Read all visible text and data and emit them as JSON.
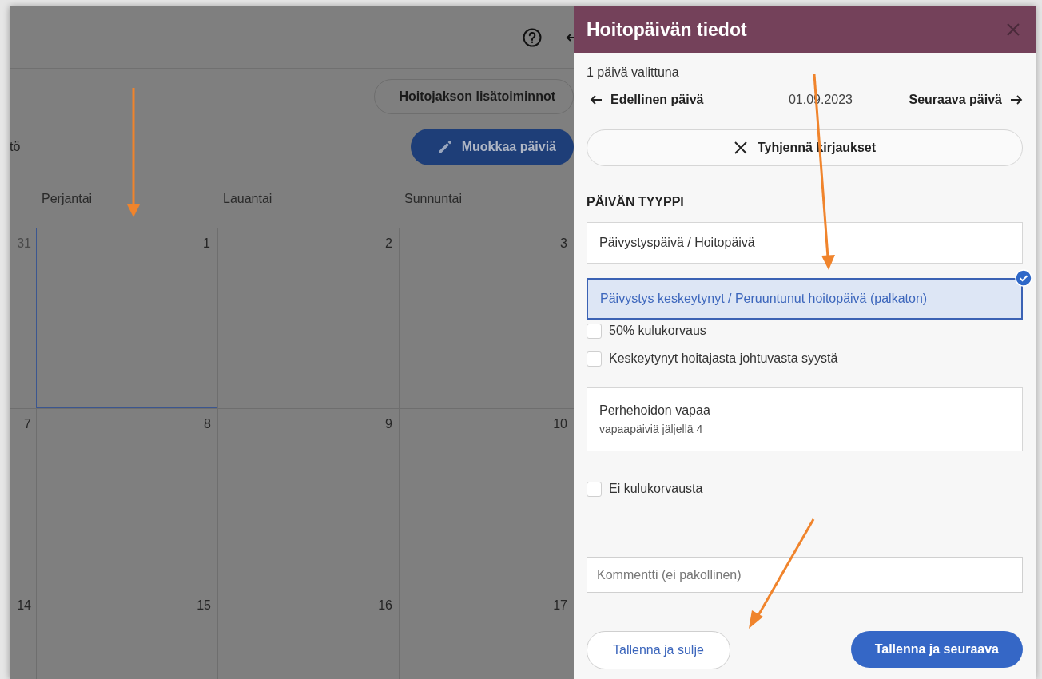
{
  "toolbar": {
    "back_arrow": true
  },
  "actions": {
    "more_button": "Hoitojakson lisätoiminnot",
    "left_text": "tö",
    "edit_button": "Muokkaa päiviä"
  },
  "calendar": {
    "weekdays": [
      "Perjantai",
      "Lauantai",
      "Sunnuntai"
    ],
    "weeks": [
      {
        "days": [
          {
            "label": "31",
            "muted": true,
            "selected": false
          },
          {
            "label": "1",
            "muted": false,
            "selected": true
          },
          {
            "label": "2",
            "muted": false,
            "selected": false
          },
          {
            "label": "3",
            "muted": false,
            "selected": false
          }
        ]
      },
      {
        "days": [
          {
            "label": "7",
            "muted": false,
            "selected": false
          },
          {
            "label": "8",
            "muted": false,
            "selected": false
          },
          {
            "label": "9",
            "muted": false,
            "selected": false
          },
          {
            "label": "10",
            "muted": false,
            "selected": false
          }
        ]
      },
      {
        "days": [
          {
            "label": "14",
            "muted": false,
            "selected": false
          },
          {
            "label": "15",
            "muted": false,
            "selected": false
          },
          {
            "label": "16",
            "muted": false,
            "selected": false
          },
          {
            "label": "17",
            "muted": false,
            "selected": false
          }
        ]
      }
    ]
  },
  "panel": {
    "title": "Hoitopäivän tiedot",
    "selection_count": "1 päivä valittuna",
    "prev_day": "Edellinen päivä",
    "date": "01.09.2023",
    "next_day": "Seuraava päivä",
    "clear_button": "Tyhjennä kirjaukset",
    "section_title": "PÄIVÄN TYYPPI",
    "day_types": [
      {
        "kind": "option",
        "label": "Päivystyspäivä / Hoitopäivä",
        "selected": false
      },
      {
        "kind": "option",
        "label": "Päivystys keskeytynyt / Peruuntunut hoitopäivä (palkaton)",
        "selected": true
      },
      {
        "kind": "checkbox",
        "label": "50% kulukorvaus",
        "checked": false
      },
      {
        "kind": "checkbox",
        "label": "Keskeytynyt hoitajasta johtuvasta syystä",
        "checked": false
      },
      {
        "kind": "option",
        "label": "Perhehoidon vapaa",
        "sublabel": "vapaapäiviä jäljellä 4",
        "selected": false
      },
      {
        "kind": "checkbox",
        "label": "Ei kulukorvausta",
        "checked": false
      }
    ],
    "comment": {
      "placeholder": "Kommentti (ei pakollinen)"
    },
    "save_close_button": "Tallenna ja sulje",
    "save_next_button": "Tallenna ja seuraava"
  }
}
